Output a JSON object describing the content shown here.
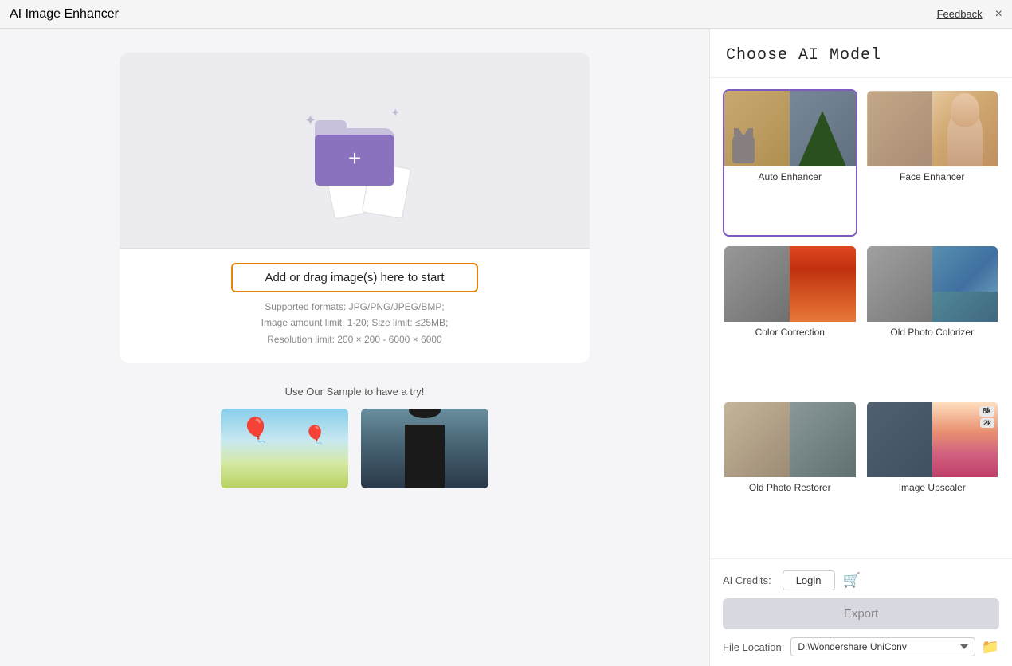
{
  "titlebar": {
    "app_title": "AI Image Enhancer",
    "feedback_label": "Feedback",
    "close_label": "×"
  },
  "right_panel": {
    "header": "Choose AI Model",
    "models": [
      {
        "id": "auto-enhancer",
        "label": "Auto Enhancer",
        "selected": true
      },
      {
        "id": "face-enhancer",
        "label": "Face Enhancer",
        "selected": false
      },
      {
        "id": "color-correction",
        "label": "Color Correction",
        "selected": false
      },
      {
        "id": "old-photo-colorizer",
        "label": "Old Photo Colorizer",
        "selected": false
      },
      {
        "id": "old-photo-restorer",
        "label": "Old Photo Restorer",
        "selected": false
      },
      {
        "id": "image-upscaler",
        "label": "Image Upscaler",
        "selected": false
      }
    ],
    "upscaler_badge_8k": "8k",
    "upscaler_badge_2k": "2k"
  },
  "bottom_bar": {
    "credits_label": "AI Credits:",
    "login_label": "Login",
    "export_label": "Export",
    "file_location_label": "File Location:",
    "file_path": "D:\\Wondershare UniConv",
    "file_path_placeholder": "D:\\Wondershare UniConv"
  },
  "left_panel": {
    "drop_label": "Add or drag image(s) here to start",
    "drop_info_line1": "Supported formats: JPG/PNG/JPEG/BMP;",
    "drop_info_line2": "Image amount limit: 1-20; Size limit: ≤25MB;",
    "drop_info_line3": "Resolution limit: 200 × 200 - 6000 × 6000",
    "sample_label": "Use Our Sample to have a try!"
  }
}
